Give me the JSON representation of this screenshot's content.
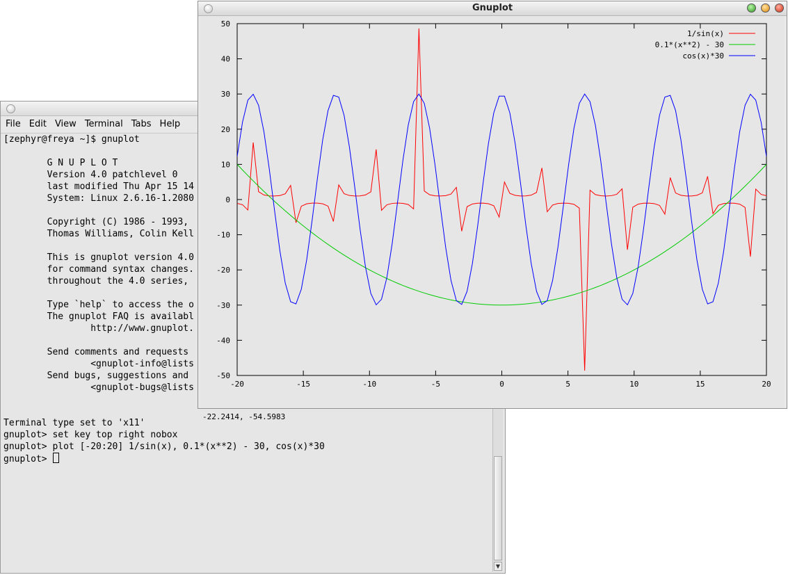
{
  "terminal": {
    "menu": [
      "File",
      "Edit",
      "View",
      "Terminal",
      "Tabs",
      "Help"
    ],
    "lines": [
      "[zephyr@freya ~]$ gnuplot",
      "",
      "        G N U P L O T",
      "        Version 4.0 patchlevel 0",
      "        last modified Thu Apr 15 14",
      "        System: Linux 2.6.16-1.2080",
      "",
      "        Copyright (C) 1986 - 1993,",
      "        Thomas Williams, Colin Kell",
      "",
      "        This is gnuplot version 4.0",
      "        for command syntax changes.",
      "        throughout the 4.0 series,",
      "",
      "        Type `help` to access the o",
      "        The gnuplot FAQ is availabl",
      "                http://www.gnuplot.",
      "",
      "        Send comments and requests",
      "                <gnuplot-info@lists",
      "        Send bugs, suggestions and",
      "                <gnuplot-bugs@lists",
      "",
      "",
      "Terminal type set to 'x11'",
      "gnuplot> set key top right nobox",
      "gnuplot> plot [-20:20] 1/sin(x), 0.1*(x**2) - 30, cos(x)*30"
    ],
    "prompt": "gnuplot> "
  },
  "gnuplot_window": {
    "title": "Gnuplot",
    "status_coords": "-22.2414, -54.5983"
  },
  "chart_data": {
    "type": "line",
    "xlim": [
      -20,
      20
    ],
    "ylim": [
      -50,
      50
    ],
    "x_ticks": [
      -20,
      -15,
      -10,
      -5,
      0,
      5,
      10,
      15,
      20
    ],
    "y_ticks": [
      -50,
      -40,
      -30,
      -20,
      -10,
      0,
      10,
      20,
      30,
      40,
      50
    ],
    "legend_position": "top-right",
    "grid": false,
    "samples": 100,
    "series": [
      {
        "name": "1/sin(x)",
        "color": "#ff0000",
        "expr": "1/sin(x)"
      },
      {
        "name": "0.1*(x**2) - 30",
        "color": "#00cc00",
        "expr": "0.1*(x**2) - 30"
      },
      {
        "name": "cos(x)*30",
        "color": "#0000ff",
        "expr": "cos(x)*30"
      }
    ]
  }
}
